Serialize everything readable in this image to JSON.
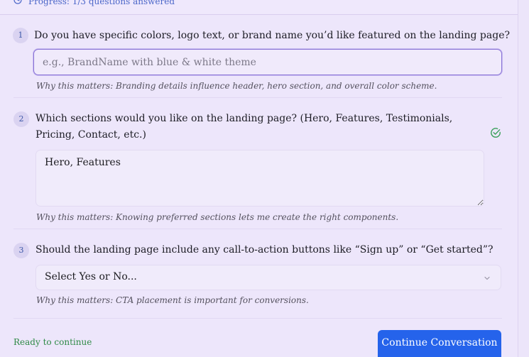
{
  "progress": {
    "icon": "clock-icon",
    "text": "Progress: 1/3 questions answered"
  },
  "questions": [
    {
      "number": "1",
      "text": "Do you have specific colors, logo text, or brand name you’d like featured on the landing page?",
      "input_placeholder": "e.g., BrandName with blue & white theme",
      "input_value": "",
      "why": "Why this matters: Branding details influence header, hero section, and overall color scheme."
    },
    {
      "number": "2",
      "text": "Which sections would you like on the landing page? (Hero, Features, Testimonials, Pricing, Contact, etc.)",
      "answer": "Hero, Features",
      "answered_icon": "check-circle-icon",
      "why": "Why this matters: Knowing preferred sections lets me create the right components."
    },
    {
      "number": "3",
      "text": "Should the landing page include any call-to-action buttons like “Sign up” or “Get started”?",
      "select_value": "Select Yes or No...",
      "select_icon": "chevron-down-icon",
      "why": "Why this matters: CTA placement is important for conversions."
    }
  ],
  "footer": {
    "status": "Ready to continue",
    "continue_label": "Continue Conversation"
  },
  "colors": {
    "accent": "#2563eb",
    "success": "#2f8a46",
    "background": "#ede6fb"
  }
}
